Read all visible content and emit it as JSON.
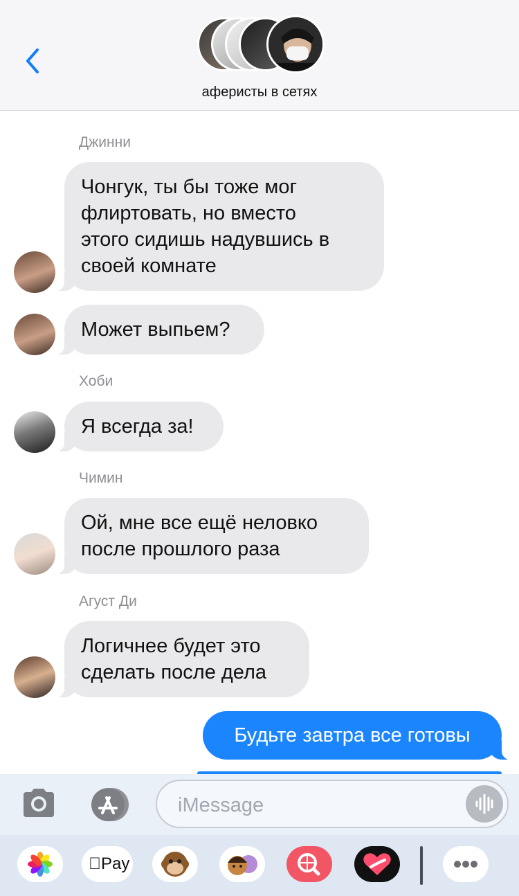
{
  "header": {
    "group_name": "аферисты в сетях",
    "back_icon": "chevron-left-icon"
  },
  "messages": [
    {
      "sender": "Джинни",
      "text": "Чонгук, ты бы тоже мог\nфлиртовать, но вместо\nэтого сидишь надувшись в\nсвоей комнате"
    },
    {
      "sender": "",
      "text": "Может выпьем?"
    },
    {
      "sender": "Хоби",
      "text": "Я всегда за!"
    },
    {
      "sender": "Чимин",
      "text": "Ой, мне все ещё неловко\nпосле прошлого раза"
    },
    {
      "sender": "Агуст Ди",
      "text": "Логичнее будет это\nсделать после дела"
    }
  ],
  "outgoing": {
    "text": "Будьте завтра все готовы"
  },
  "input": {
    "placeholder": "iMessage"
  },
  "app_tray": {
    "apple_pay_label": "Pay",
    "items": [
      "photos-icon",
      "apple-pay-icon",
      "animoji-monkey-icon",
      "memoji-icon",
      "image-search-icon",
      "digital-touch-icon",
      "more-icon"
    ]
  },
  "colors": {
    "outgoing_bubble": "#1b85fe",
    "incoming_bubble": "#e9e9eb",
    "accent": "#157efb"
  }
}
